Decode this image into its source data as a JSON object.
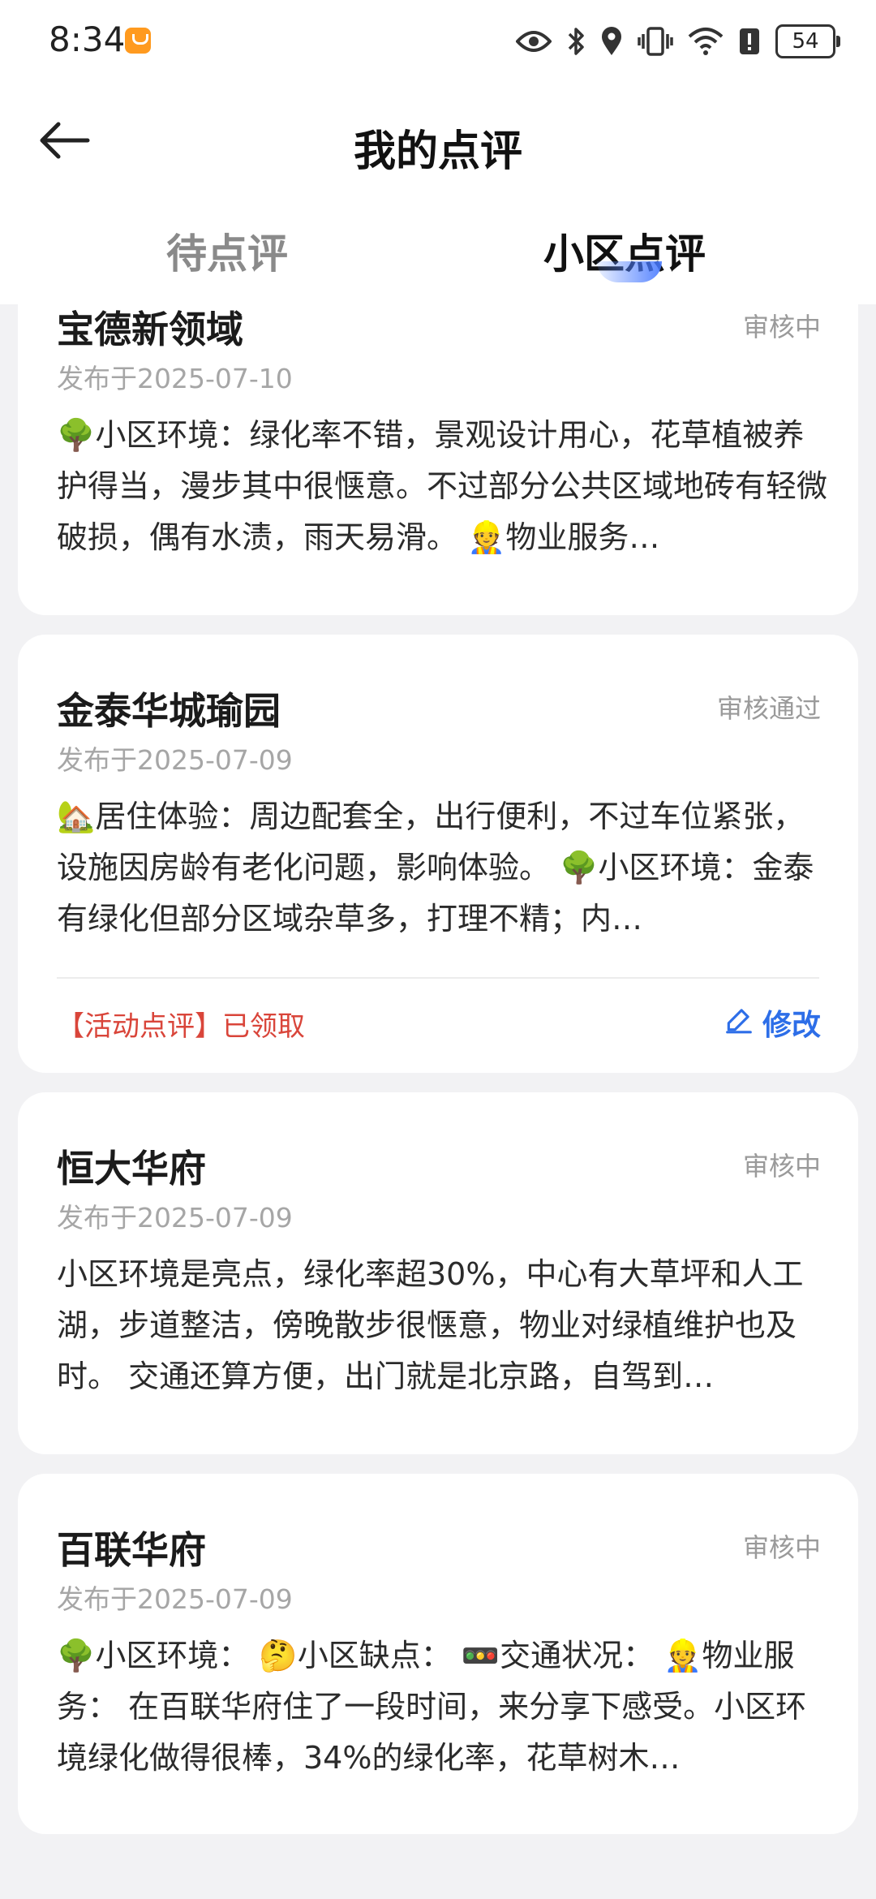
{
  "status_bar": {
    "time": "8:34",
    "battery": "54",
    "icons": [
      "app-badge-icon",
      "eye-icon",
      "bluetooth-icon",
      "location-icon",
      "vibrate-icon",
      "wifi-icon",
      "alert-icon",
      "battery-icon"
    ]
  },
  "header": {
    "title": "我的点评"
  },
  "tabs": [
    {
      "label": "待点评",
      "active": false
    },
    {
      "label": "小区点评",
      "active": true
    }
  ],
  "colors": {
    "accent": "#2d6ee8",
    "activity_red": "#d9453a",
    "background": "#f2f2f4"
  },
  "reviews": [
    {
      "name": "宝德新领域",
      "status": "审核中",
      "date": "发布于2025-07-10",
      "body": "🌳小区环境：绿化率不错，景观设计用心，花草植被养护得当，漫步其中很惬意。不过部分公共区域地砖有轻微破损，偶有水渍，雨天易滑。 👷物业服务…"
    },
    {
      "name": "金泰华城瑜园",
      "status": "审核通过",
      "date": "发布于2025-07-09",
      "body": "🏡居住体验：周边配套全，出行便利，不过车位紧张，设施因房龄有老化问题，影响体验。 🌳小区环境：金泰有绿化但部分区域杂草多，打理不精；内…",
      "activity": "【活动点评】已领取",
      "edit_label": "修改"
    },
    {
      "name": "恒大华府",
      "status": "审核中",
      "date": "发布于2025-07-09",
      "body": "小区环境是亮点，绿化率超30%，中心有大草坪和人工湖，步道整洁，傍晚散步很惬意，物业对绿植维护也及时。 交通还算方便，出门就是北京路，自驾到…"
    },
    {
      "name": "百联华府",
      "status": "审核中",
      "date": "发布于2025-07-09",
      "body": "🌳小区环境： 🤔小区缺点： 🚥交通状况： 👷物业服务：  在百联华府住了一段时间，来分享下感受。小区环境绿化做得很棒，34%的绿化率，花草树木…"
    }
  ]
}
